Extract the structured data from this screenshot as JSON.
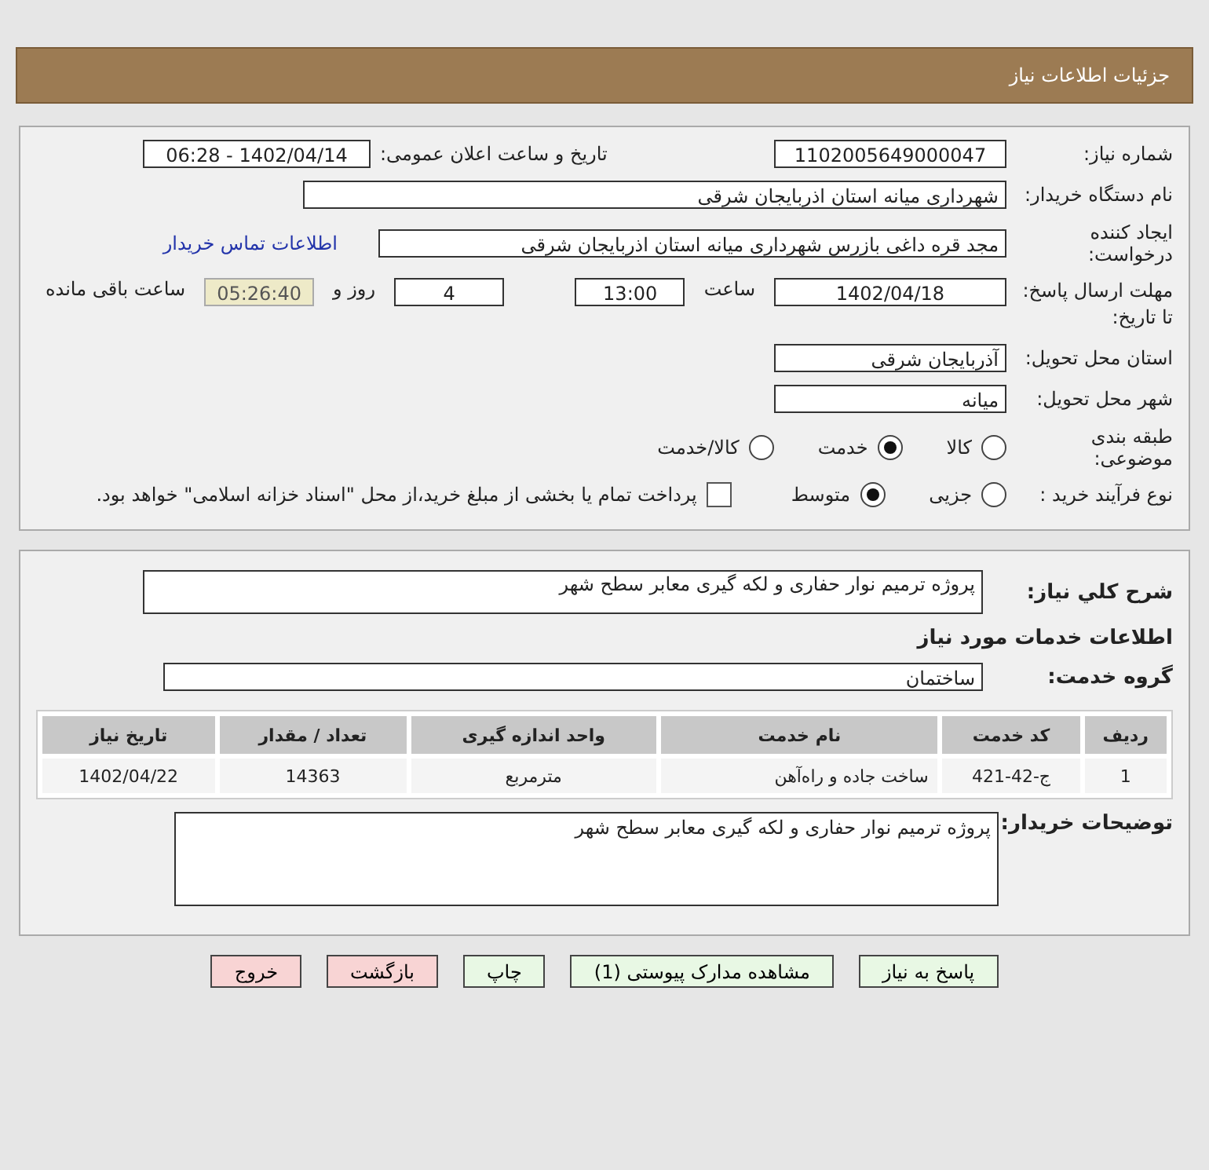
{
  "header": {
    "title": "جزئیات اطلاعات نیاز"
  },
  "need_number": {
    "label": "شماره نیاز:",
    "value": "1102005649000047"
  },
  "announce": {
    "label": "تاریخ و ساعت اعلان عمومی:",
    "value": "1402/04/14 - 06:28"
  },
  "buyer_org": {
    "label": "نام دستگاه خریدار:",
    "value": "شهرداری میانه استان اذربایجان شرقی"
  },
  "requester": {
    "label": "ایجاد کننده درخواست:",
    "value": "مجد قره داغی بازرس شهرداری میانه استان اذربایجان شرقی",
    "contact_link": "اطلاعات تماس خریدار"
  },
  "deadline": {
    "label": "مهلت ارسال پاسخ: تا تاریخ:",
    "date": "1402/04/18",
    "time_label": "ساعت",
    "time": "13:00",
    "days": "4",
    "days_label": "روز و",
    "remaining": "05:26:40",
    "remaining_label": "ساعت باقی مانده"
  },
  "province": {
    "label": "استان محل تحویل:",
    "value": "آذربایجان شرقی"
  },
  "city": {
    "label": "شهر محل تحویل:",
    "value": "میانه"
  },
  "category": {
    "label": "طبقه بندی موضوعی:",
    "options": [
      {
        "label": "کالا",
        "selected": false
      },
      {
        "label": "خدمت",
        "selected": true
      },
      {
        "label": "کالا/خدمت",
        "selected": false
      }
    ]
  },
  "process": {
    "label": "نوع فرآیند خرید :",
    "options": [
      {
        "label": "جزیی",
        "selected": false
      },
      {
        "label": "متوسط",
        "selected": true
      }
    ],
    "payment_checkbox": {
      "checked": false,
      "text": "پرداخت تمام یا بخشی از مبلغ خرید،از محل \"اسناد خزانه اسلامی\" خواهد بود."
    }
  },
  "description": {
    "label": "شرح کلي نياز:",
    "value": "پروژه ترمیم نوار حفاری و لکه گیری معابر سطح شهر"
  },
  "services_title": "اطلاعات خدمات مورد نیاز",
  "service_group": {
    "label": "گروه خدمت:",
    "value": "ساختمان"
  },
  "table": {
    "columns": [
      "ردیف",
      "کد خدمت",
      "نام خدمت",
      "واحد اندازه گیری",
      "تعداد / مقدار",
      "تاریخ نیاز"
    ],
    "rows": [
      [
        "1",
        "ج-42-421",
        "ساخت جاده و راه‌آهن",
        "مترمربع",
        "14363",
        "1402/04/22"
      ]
    ]
  },
  "buyer_notes": {
    "label": "توضیحات خریدار:",
    "value": "پروژه ترمیم نوار حفاری و لکه گیری معابر سطح شهر"
  },
  "buttons": [
    {
      "label": "پاسخ به نیاز",
      "kind": "primary"
    },
    {
      "label": "مشاهده مدارک پیوستی (1)",
      "kind": "primary"
    },
    {
      "label": "چاپ",
      "kind": "primary"
    },
    {
      "label": "بازگشت",
      "kind": "danger"
    },
    {
      "label": "خروج",
      "kind": "danger"
    }
  ]
}
